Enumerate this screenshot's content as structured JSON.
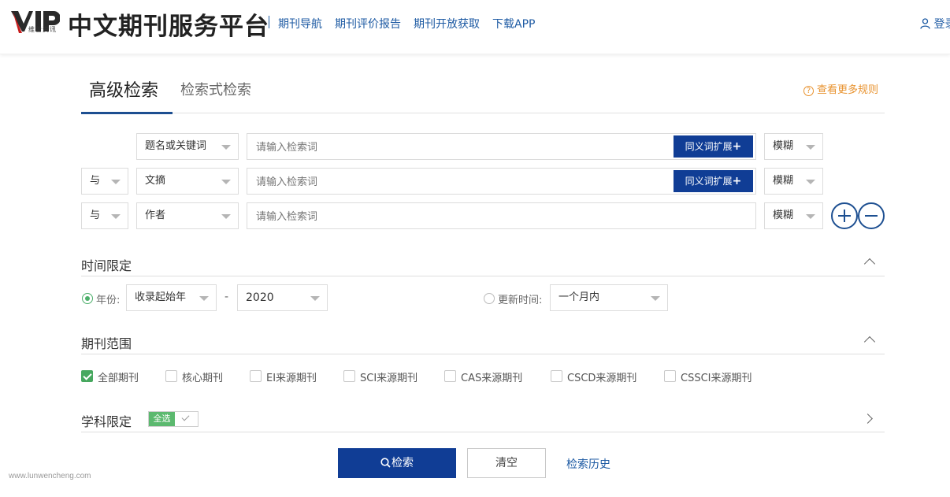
{
  "header": {
    "logo_text": "VIP",
    "logo_sub": "维普资讯",
    "brand": "中文期刊服务平台",
    "nav": [
      "期刊导航",
      "期刊评价报告",
      "期刊开放获取",
      "下载APP"
    ],
    "login": "登录"
  },
  "tabs": {
    "active": "高级检索",
    "other": "检索式检索",
    "more_rules": "查看更多规则"
  },
  "search_rows": [
    {
      "logic": "",
      "field": "题名或关键词",
      "placeholder": "请输入检索词",
      "synonym": "同义词扩展",
      "match": "模糊"
    },
    {
      "logic": "与",
      "field": "文摘",
      "placeholder": "请输入检索词",
      "synonym": "同义词扩展",
      "match": "模糊"
    },
    {
      "logic": "与",
      "field": "作者",
      "placeholder": "请输入检索词",
      "synonym": "",
      "match": "模糊"
    }
  ],
  "time": {
    "title": "时间限定",
    "year_label": "年份:",
    "from": "收录起始年",
    "dash": "-",
    "to": "2020",
    "update_label": "更新时间:",
    "update_value": "一个月内"
  },
  "scope": {
    "title": "期刊范围",
    "options": [
      {
        "label": "全部期刊",
        "checked": true
      },
      {
        "label": "核心期刊",
        "checked": false
      },
      {
        "label": "EI来源期刊",
        "checked": false
      },
      {
        "label": "SCI来源期刊",
        "checked": false
      },
      {
        "label": "CAS来源期刊",
        "checked": false
      },
      {
        "label": "CSCD来源期刊",
        "checked": false
      },
      {
        "label": "CSSCI来源期刊",
        "checked": false
      }
    ]
  },
  "subject": {
    "title": "学科限定",
    "select_all": "全选"
  },
  "actions": {
    "search": "检索",
    "clear": "清空",
    "history": "检索历史"
  },
  "watermark": "www.lunwencheng.com",
  "colors": {
    "primary": "#103d95",
    "link": "#1d5aa3",
    "accent_orange": "#e8922e",
    "check_green": "#47a85f"
  }
}
